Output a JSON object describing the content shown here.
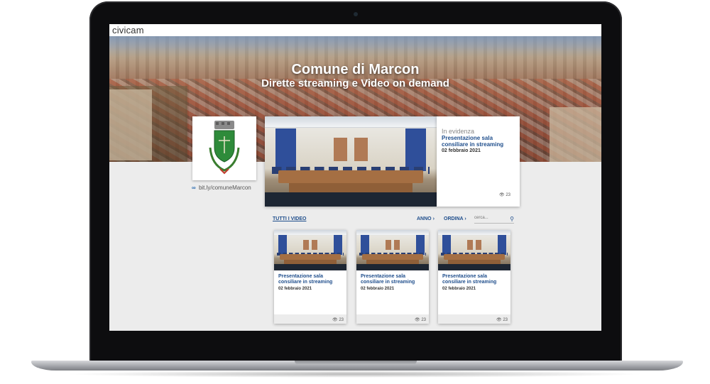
{
  "brand": {
    "logo_text": "civicam"
  },
  "hero": {
    "title": "Comune di Marcon",
    "subtitle": "Dirette streaming e Video on demand"
  },
  "profile": {
    "short_link": "bit.ly/comuneMarcon"
  },
  "featured": {
    "label": "In evidenza",
    "title": "Presentazione sala consiliare in streaming",
    "date": "02 febbraio 2021",
    "views": "23"
  },
  "controls": {
    "all_videos": "TUTTI I VIDEO",
    "year": "ANNO",
    "sort": "ORDINA",
    "search_placeholder": "cerca..."
  },
  "videos": [
    {
      "title": "Presentazione sala consiliare in streaming",
      "date": "02 febbraio 2021",
      "views": "23"
    },
    {
      "title": "Presentazione sala consiliare in streaming",
      "date": "02 febbraio 2021",
      "views": "23"
    },
    {
      "title": "Presentazione sala consiliare in streaming",
      "date": "02 febbraio 2021",
      "views": "23"
    }
  ],
  "colors": {
    "accent": "#1f4e8c",
    "brand_blue": "#2b7fb8",
    "crest_green": "#2e8b3a"
  }
}
